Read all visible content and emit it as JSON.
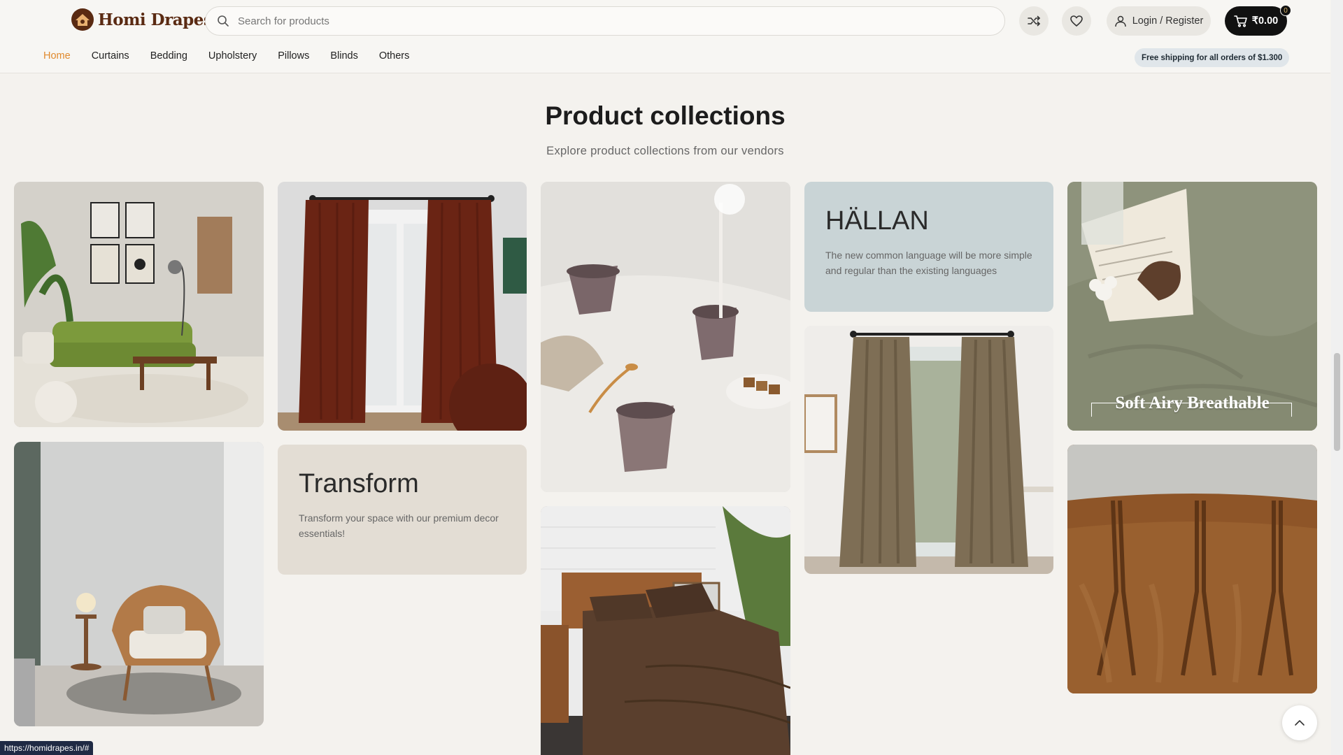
{
  "header": {
    "logo_text": "Homi Drapes",
    "search_placeholder": "Search for products",
    "login_label": "Login / Register",
    "cart_total": "₹0.00",
    "cart_count": "0"
  },
  "nav": {
    "items": [
      {
        "label": "Home",
        "active": true
      },
      {
        "label": "Curtains"
      },
      {
        "label": "Bedding"
      },
      {
        "label": "Upholstery"
      },
      {
        "label": "Pillows"
      },
      {
        "label": "Blinds"
      },
      {
        "label": "Others"
      }
    ],
    "shipping_note": "Free shipping for all orders of $1.300"
  },
  "section": {
    "title": "Product collections",
    "subtitle": "Explore product collections from our vendors"
  },
  "cards": {
    "hallan": {
      "heading": "HÄLLAN",
      "text": "The new common language will be more simple and regular than the existing languages"
    },
    "transform": {
      "heading": "Transform",
      "text": "Transform your space with our premium decor essentials!"
    },
    "soft_airy_caption": "Soft Airy Breathable"
  },
  "status_url": "https://homidrapes.in/#",
  "colors": {
    "accent": "#e08a2e",
    "brand": "#5a2a12",
    "hallan_bg": "#c9d4d6",
    "transform_bg": "#e3ddd4"
  }
}
